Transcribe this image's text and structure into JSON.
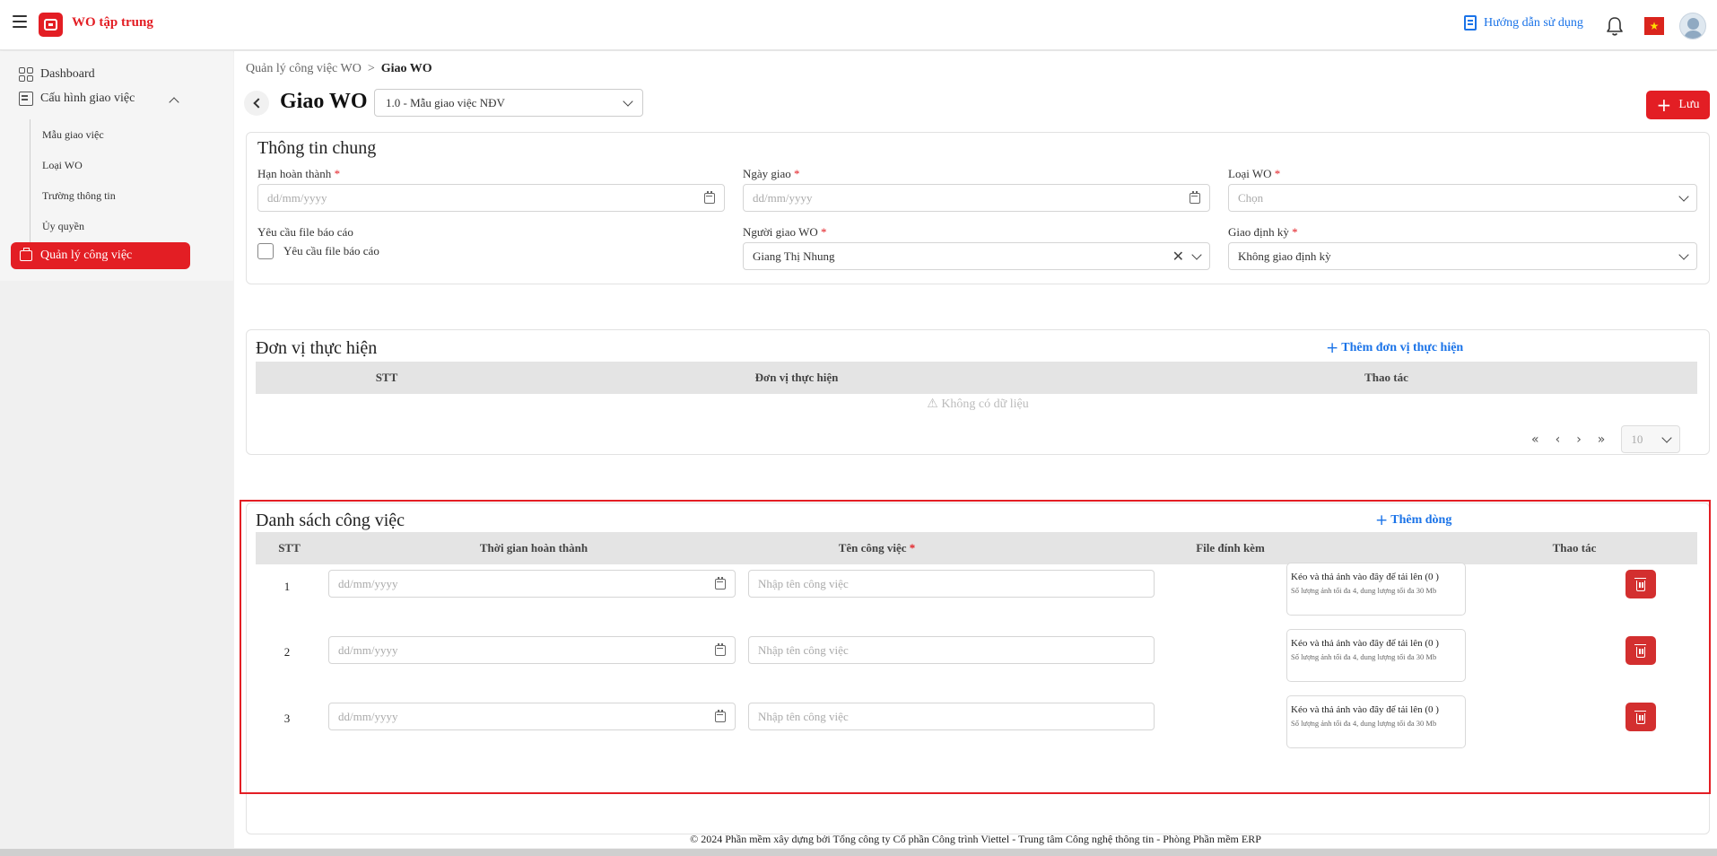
{
  "app": {
    "title": "WO tập trung"
  },
  "header": {
    "guide_label": "Hướng dẫn sử dụng",
    "flag_star": "★"
  },
  "sidebar": {
    "dashboard": "Dashboard",
    "config": "Cấu hình giao việc",
    "sub_items": [
      "Mẫu giao việc",
      "Loại WO",
      "Trường thông tin",
      "Ủy quyền"
    ],
    "active": "Quản lý công việc"
  },
  "breadcrumb": {
    "parent": "Quản lý công việc WO",
    "separator": ">",
    "current": "Giao WO"
  },
  "page": {
    "title": "Giao WO",
    "template_value": "1.0 - Mẫu giao việc NĐV",
    "save_label": "Lưu",
    "plus": "+"
  },
  "general": {
    "title": "Thông tin chung",
    "deadline_label": "Hạn hoàn thành",
    "deadline_placeholder": "dd/mm/yyyy",
    "assign_date_label": "Ngày giao",
    "assign_date_placeholder": "dd/mm/yyyy",
    "wo_type_label": "Loại WO",
    "wo_type_placeholder": "Chọn",
    "report_label": "Yêu cầu file báo cáo",
    "report_checkbox_label": "Yêu cầu file báo cáo",
    "assigner_label": "Người giao WO",
    "assigner_value": "Giang Thị Nhung",
    "periodic_label": "Giao định kỳ",
    "periodic_value": "Không giao định kỳ",
    "required_mark": "*",
    "clear": "✕"
  },
  "units": {
    "title": "Đơn vị thực hiện",
    "add_label": "Thêm đơn vị thực hiện",
    "columns": [
      "STT",
      "Đơn vị thực hiện",
      "Thao tác"
    ],
    "empty": "⚠ Không có dữ liệu",
    "pager": {
      "first": "«",
      "prev": "‹",
      "next": "›",
      "last": "»",
      "page_size": "10"
    }
  },
  "tasks": {
    "title": "Danh sách công việc",
    "add_label": "Thêm dòng",
    "columns": [
      "STT",
      "Thời gian hoàn thành",
      "Tên công việc",
      "File đính kèm",
      "Thao tác"
    ],
    "required_mark": "*",
    "date_placeholder": "dd/mm/yyyy",
    "name_placeholder": "Nhập tên công việc",
    "upload_text": "Kéo và thả ảnh vào đây để tải lên (0 )",
    "upload_hint": "Số lượng ảnh tối đa 4, dung lượng tối đa 30 Mb",
    "rows": [
      {
        "stt": "1"
      },
      {
        "stt": "2"
      },
      {
        "stt": "3"
      }
    ]
  },
  "footer": {
    "text": "© 2024 Phần mềm xây dựng bởi Tổng công ty Cổ phần Công trình Viettel - Trung tâm Công nghệ thông tin - Phòng Phần mềm ERP"
  },
  "colors": {
    "brand": "#e31e24",
    "link": "#1a73e8",
    "delete": "#d32f2f"
  }
}
